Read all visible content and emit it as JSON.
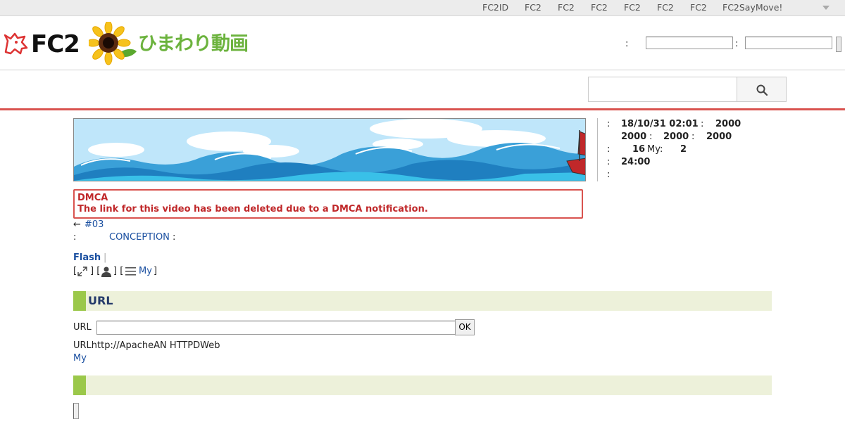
{
  "topnav": {
    "items": [
      "FC2ID",
      "FC2",
      "FC2",
      "FC2",
      "FC2",
      "FC2",
      "FC2",
      "FC2SayMove!"
    ]
  },
  "header": {
    "logo_text": "FC2",
    "site_name": "ひまわり動画",
    "login_colon_1": ":",
    "login_colon_2": ":"
  },
  "search": {
    "icon": "search-icon"
  },
  "info": {
    "c1": ":",
    "date": "18/10/31 02:01",
    "c2": ":",
    "v1": "2000",
    "r2a": "2000",
    "c3": ":",
    "r2b": "2000",
    "c4": ":",
    "r2c": "2000",
    "c5": ":",
    "r3a": "16",
    "my_label": "My:",
    "r3b": "2",
    "c6": ":",
    "r4a": "24:00",
    "c7": ":"
  },
  "dmca": {
    "title": "DMCA",
    "message": "The link for this video has been deleted due to a DMCA notification."
  },
  "video": {
    "prev_arrow": "←",
    "prev_link": "#03",
    "meta_colon": ":",
    "meta_link": "CONCEPTION",
    "meta_colon2": ":",
    "flash_label": "Flash",
    "flash_sep": "|",
    "tools_open": "[",
    "tools_mid1": "] [",
    "tools_mid2": "] [",
    "tools_my": "My",
    "tools_close": "]"
  },
  "url_section": {
    "title": "URL",
    "field_label": "URL",
    "ok_label": "OK",
    "note": "URLhttp://ApacheAN HTTPDWeb",
    "my_link": "My"
  },
  "colors": {
    "accent_red": "#d9534f",
    "section_bg": "#edf1da",
    "section_accent": "#9bc84a",
    "link": "#1a4fa0",
    "dmca_text": "#c0282a"
  }
}
